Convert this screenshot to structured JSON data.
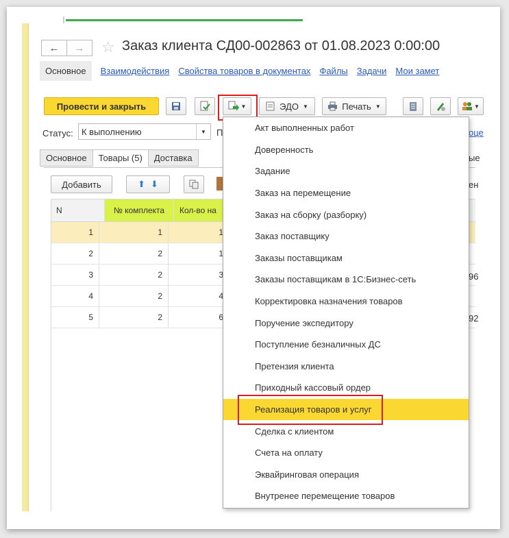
{
  "window": {
    "title": "Заказ клиента СД00-002863 от 01.08.2023 0:00:00"
  },
  "nav": {
    "back_icon": "arrow-left-icon",
    "forward_icon": "arrow-right-icon",
    "back_glyph": "←",
    "forward_glyph": "→",
    "star_glyph": "☆"
  },
  "links": {
    "active": "Основное",
    "items": [
      "Взаимодействия",
      "Свойства товаров в документах",
      "Файлы",
      "Задачи",
      "Мои замет"
    ]
  },
  "toolbar": {
    "post_and_close": "Провести и закрыть",
    "edo": "ЭДО",
    "print": "Печать"
  },
  "status": {
    "label": "Статус:",
    "value": "К выполнению",
    "next_label": "П",
    "right_link": "оце"
  },
  "tabs": {
    "items": [
      "Основное",
      "Товары (5)",
      "Доставка"
    ],
    "right_fragment": "ые",
    "selected_index": 1
  },
  "table_toolbar": {
    "add": "Добавить",
    "right_fragment": "ен"
  },
  "table": {
    "columns": [
      "N",
      "№ комплекта",
      "Кол-во на"
    ],
    "rows": [
      {
        "n": "1",
        "kit": "1",
        "qty": "1",
        "extra": ""
      },
      {
        "n": "2",
        "kit": "2",
        "qty": "1",
        "extra": ""
      },
      {
        "n": "3",
        "kit": "2",
        "qty": "3",
        "extra": "96"
      },
      {
        "n": "4",
        "kit": "2",
        "qty": "4",
        "extra": ""
      },
      {
        "n": "5",
        "kit": "2",
        "qty": "6",
        "extra": "92"
      }
    ]
  },
  "menu": {
    "items": [
      "Акт выполненных работ",
      "Доверенность",
      "Задание",
      "Заказ на перемещение",
      "Заказ на сборку (разборку)",
      "Заказ поставщику",
      "Заказы поставщикам",
      "Заказы поставщикам в 1С:Бизнес-сеть",
      "Корректировка назначения товаров",
      "Поручение экспедитору",
      "Поступление безналичных ДС",
      "Претензия клиента",
      "Приходный кассовый ордер",
      "Реализация товаров и услуг",
      "Сделка с клиентом",
      "Счета на оплату",
      "Эквайринговая операция",
      "Внутренее перемещение товаров"
    ],
    "highlighted_index": 13
  },
  "colors": {
    "accent_yellow": "#fbd732",
    "highlight_red": "#e01b1b",
    "link_blue": "#2a5bb8",
    "column_green": "#d8f24a",
    "selected_row": "#fbeebc"
  }
}
